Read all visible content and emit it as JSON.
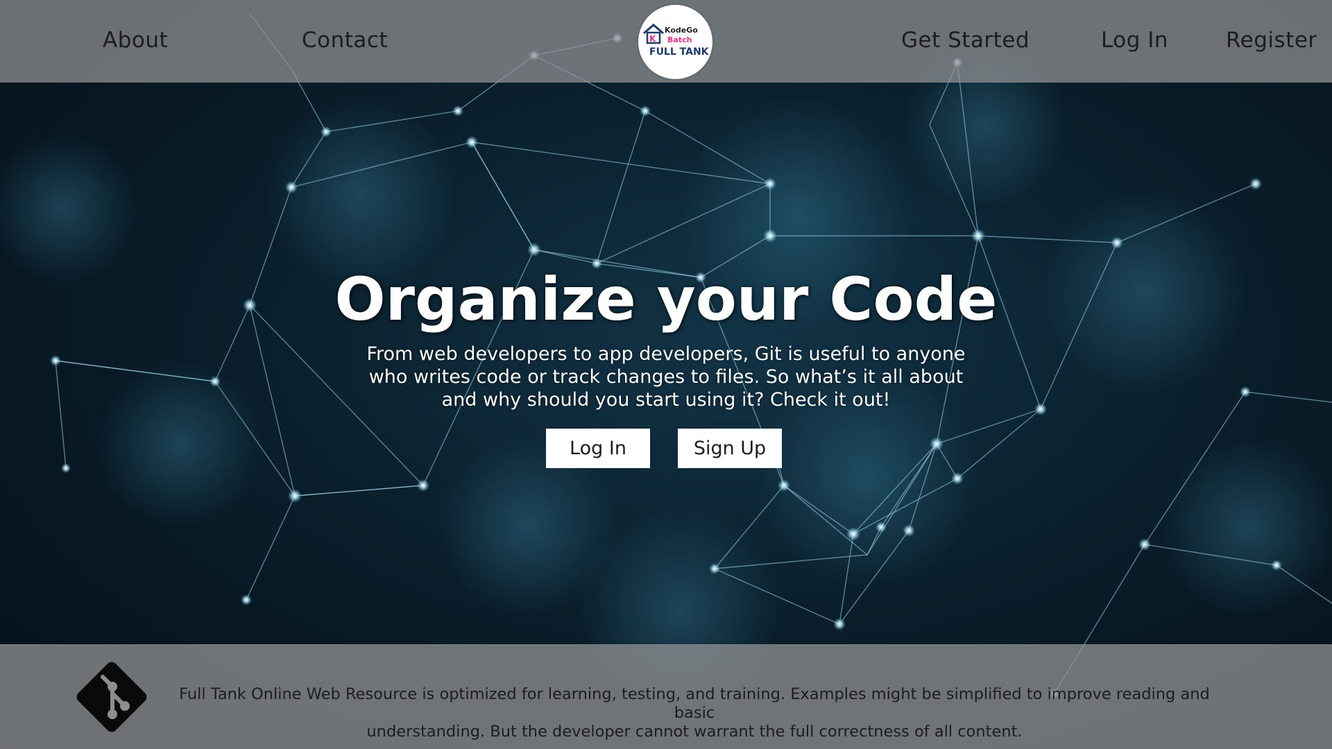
{
  "header": {
    "nav_left": [
      {
        "label": "About"
      },
      {
        "label": "Contact"
      }
    ],
    "nav_right": [
      {
        "label": "Get Started"
      },
      {
        "label": "Log In"
      },
      {
        "label": "Register"
      }
    ],
    "logo": {
      "line1": "KodeGo",
      "line2": "Batch",
      "line3": "FULL TANK",
      "letter": "K",
      "icon": "house-icon"
    }
  },
  "hero": {
    "title": "Organize your Code",
    "description_lines": [
      "From web developers to app developers, Git is useful to anyone",
      "who writes code or track changes to files. So what’s it all about",
      "and why should you start using it? Check it out!"
    ],
    "buttons": {
      "login": "Log In",
      "signup": "Sign Up"
    }
  },
  "footer": {
    "icon": "git-icon",
    "text_lines": [
      "Full Tank Online Web Resource is optimized for learning, testing, and training. Examples might be simplified to improve reading and basic",
      "understanding. But the developer cannot warrant the full correctness of all content."
    ]
  },
  "colors": {
    "header_bg": "#949494",
    "footer_bg": "#949494",
    "hero_bg": "#0a1f2c",
    "network_line": "#9fd6ea",
    "logo_pink": "#e8308b",
    "logo_navy": "#1e3a6e",
    "text_dark": "#1d1d1d"
  }
}
